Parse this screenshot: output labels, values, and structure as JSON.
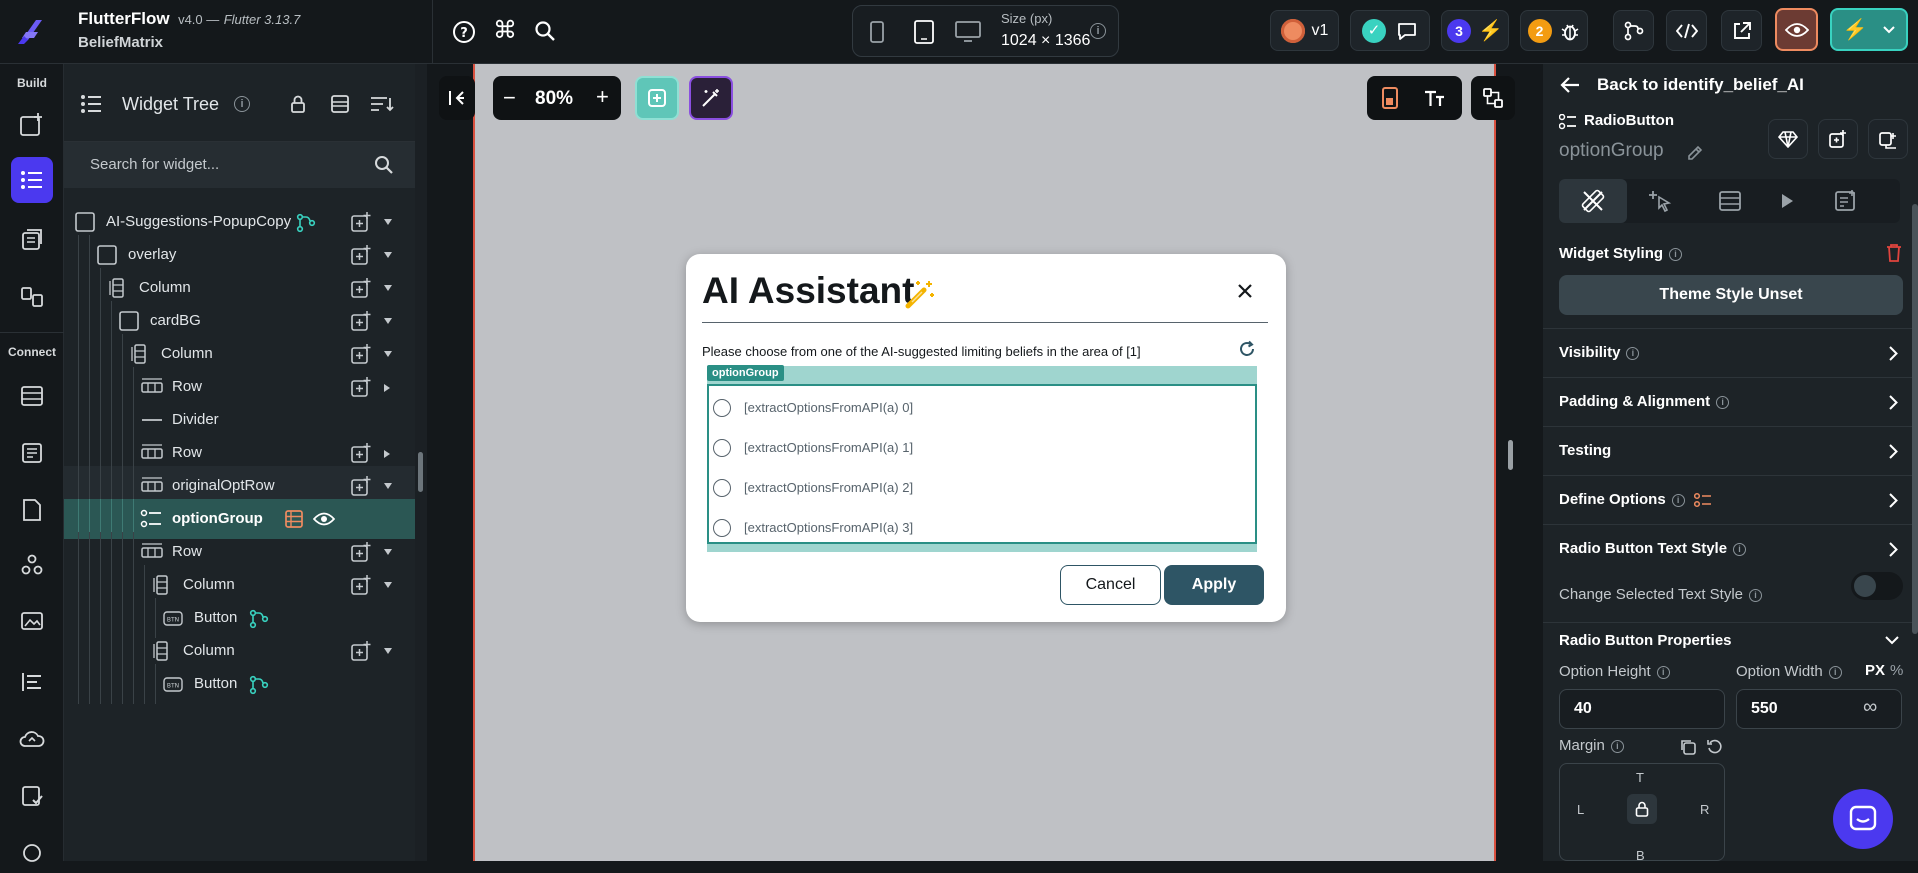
{
  "app": {
    "name": "FlutterFlow",
    "version": "v4.0 —",
    "flutter_version": "Flutter 3.13.7",
    "project": "BeliefMatrix"
  },
  "topbar": {
    "size_label": "Size (px)",
    "size_value": "1024 × 1366",
    "version_badge": "v1",
    "badge_blue": "3",
    "badge_orange": "2"
  },
  "rail": {
    "build_label": "Build",
    "connect_label": "Connect"
  },
  "tree": {
    "title": "Widget Tree",
    "search_placeholder": "Search for widget...",
    "rows": [
      {
        "label": "AI-Suggestions-PopupCopy"
      },
      {
        "label": "overlay"
      },
      {
        "label": "Column"
      },
      {
        "label": "cardBG"
      },
      {
        "label": "Column"
      },
      {
        "label": "Row"
      },
      {
        "label": "Divider"
      },
      {
        "label": "Row"
      },
      {
        "label": "originalOptRow"
      },
      {
        "label": "optionGroup"
      },
      {
        "label": "Row"
      },
      {
        "label": "Column"
      },
      {
        "label": "Button"
      },
      {
        "label": "Column"
      },
      {
        "label": "Button"
      }
    ]
  },
  "canvas": {
    "zoom": "80%"
  },
  "dialog": {
    "title": "AI Assistant",
    "prompt": "Please choose from one of the AI-suggested limiting beliefs in the area of [1]",
    "group_tag": "optionGroup",
    "options": [
      "[extractOptionsFromAPI(a) 0]",
      "[extractOptionsFromAPI(a) 1]",
      "[extractOptionsFromAPI(a) 2]",
      "[extractOptionsFromAPI(a) 3]"
    ],
    "cancel": "Cancel",
    "apply": "Apply"
  },
  "props": {
    "back": "Back to identify_belief_AI",
    "widget_type": "RadioButton",
    "widget_name": "optionGroup",
    "widget_styling": "Widget Styling",
    "theme_button": "Theme Style Unset",
    "sections": [
      "Visibility",
      "Padding & Alignment",
      "Testing",
      "Define Options",
      "Radio Button Text Style"
    ],
    "change_selected": "Change Selected Text Style",
    "rbp_title": "Radio Button Properties",
    "option_height_label": "Option Height",
    "option_height": "40",
    "option_width_label": "Option Width",
    "option_width": "550",
    "unit_px": "PX",
    "unit_pct": "%",
    "margin_label": "Margin",
    "margin_t": "T",
    "margin_l": "L",
    "margin_r": "R",
    "margin_b": "B"
  },
  "colors": {
    "accent": "#4b39ef",
    "teal": "#39d2c0",
    "dialog_primary": "#2e5565",
    "selection": "#2b5754"
  }
}
